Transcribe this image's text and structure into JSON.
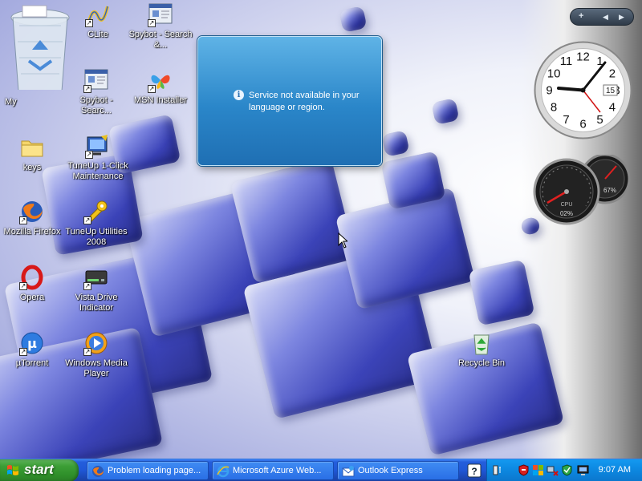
{
  "desktop": {
    "icons": [
      {
        "label": "My"
      },
      {
        "label": "СLite"
      },
      {
        "label": "Spybot - Search &..."
      },
      {
        "label": "Spybot - Searc..."
      },
      {
        "label": "MSN Installer"
      },
      {
        "label": "keys"
      },
      {
        "label": "TuneUp 1-Click Maintenance"
      },
      {
        "label": "Mozilla Firefox"
      },
      {
        "label": "TuneUp Utilities 2008"
      },
      {
        "label": "Opera"
      },
      {
        "label": "Vista Drive Indicator"
      },
      {
        "label": "µTorrent"
      },
      {
        "label": "Windows Media Player"
      },
      {
        "label": "Recycle Bin"
      }
    ]
  },
  "balloon": {
    "message": "Service not available in your language or region.",
    "icon": "info-icon"
  },
  "sidebar": {
    "bar_buttons": [
      "+",
      "◀",
      "▶"
    ],
    "clock": {
      "date": "15",
      "numerals": [
        "12",
        "1",
        "2",
        "3",
        "4",
        "5",
        "6",
        "7",
        "8",
        "9",
        "10",
        "11"
      ]
    },
    "meters": {
      "cpu_label": "CPU",
      "cpu_value": "02%",
      "ram_value": "67%"
    }
  },
  "taskbar": {
    "start_label": "start",
    "tasks": [
      {
        "label": "Problem loading page...",
        "icon": "firefox-icon"
      },
      {
        "label": "Microsoft Azure Web...",
        "icon": "ie-icon"
      },
      {
        "label": "Outlook Express",
        "icon": "outlook-express-icon"
      }
    ],
    "time": "9:07 AM"
  },
  "colors": {
    "taskbar": "#245edc",
    "start": "#3c9e36",
    "tray": "#0d8ae3",
    "balloon": "#2a86c9"
  }
}
